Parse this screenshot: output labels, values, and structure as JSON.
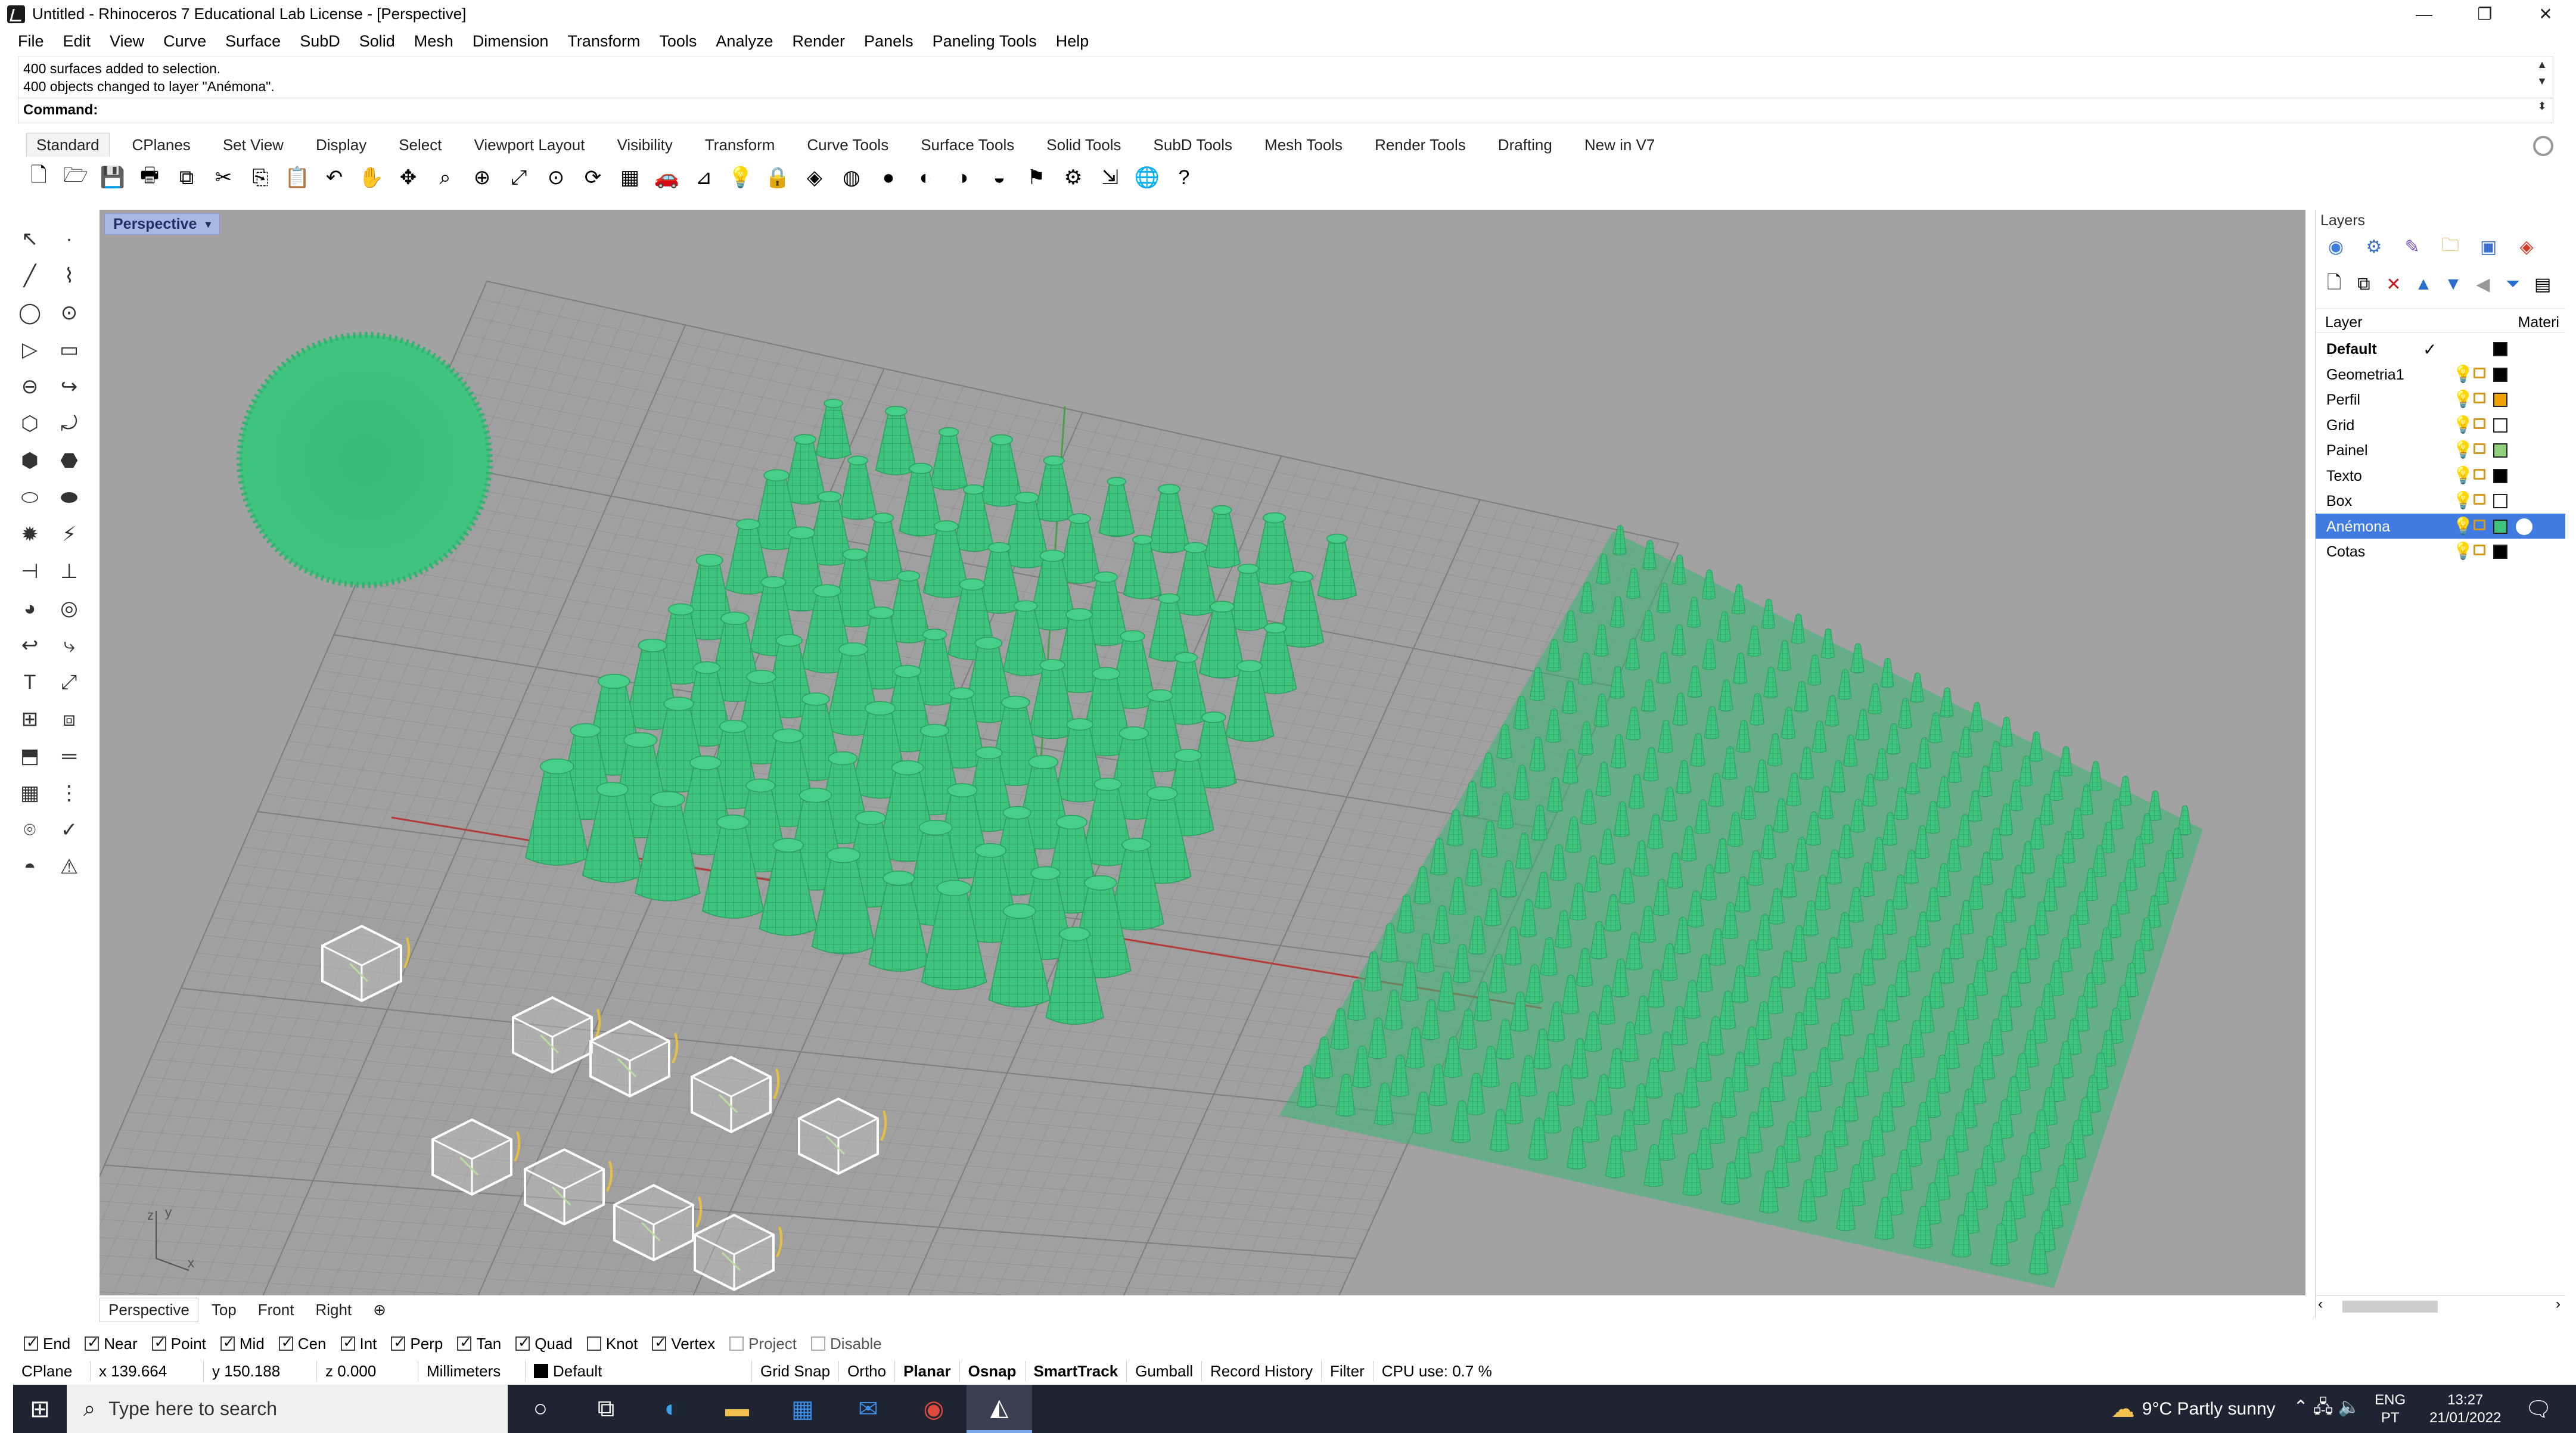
{
  "window": {
    "title": "Untitled - Rhinoceros 7 Educational Lab License - [Perspective]",
    "minimize": "—",
    "restore": "❐",
    "close": "✕"
  },
  "menu": [
    "File",
    "Edit",
    "View",
    "Curve",
    "Surface",
    "SubD",
    "Solid",
    "Mesh",
    "Dimension",
    "Transform",
    "Tools",
    "Analyze",
    "Render",
    "Panels",
    "Paneling Tools",
    "Help"
  ],
  "command_history": {
    "line1": "400 surfaces added to selection.",
    "line2": "400 objects changed to layer \"Anémona\".",
    "prompt": "Command:"
  },
  "toolbar_tabs": [
    "Standard",
    "CPlanes",
    "Set View",
    "Display",
    "Select",
    "Viewport Layout",
    "Visibility",
    "Transform",
    "Curve Tools",
    "Surface Tools",
    "Solid Tools",
    "SubD Tools",
    "Mesh Tools",
    "Render Tools",
    "Drafting",
    "New in V7"
  ],
  "toolbar_icons": [
    "new-icon",
    "open-icon",
    "save-icon",
    "print-icon",
    "import-icon",
    "cut-icon",
    "copy-icon",
    "paste-icon",
    "undo-icon",
    "pan-icon",
    "rotate-view-icon",
    "zoom-dynamic-icon",
    "zoom-window-icon",
    "zoom-extents-icon",
    "zoom-selected-icon",
    "rotate-icon",
    "four-views-icon",
    "car-icon",
    "cplane-icon",
    "point-icon",
    "light-icon",
    "lock-icon",
    "layer-icon",
    "color-wheel-icon",
    "wireframe-icon",
    "shaded-icon",
    "rendered-icon",
    "select-filter-icon",
    "options-gear-icon",
    "history-icon",
    "render-globe-icon",
    "help-icon"
  ],
  "viewport": {
    "name": "Perspective",
    "caret": "▾",
    "tabs": [
      "Perspective",
      "Top",
      "Front",
      "Right"
    ],
    "add_tab": "⊕",
    "axes_z": "z",
    "axes_y": "y",
    "axes_x": "x"
  },
  "layers_panel": {
    "title": "Layers",
    "col_layer": "Layer",
    "col_material": "Materi",
    "rows": [
      {
        "name": "Default",
        "color": "#000000",
        "current": true
      },
      {
        "name": "Geometria1",
        "color": "#000000"
      },
      {
        "name": "Perfil",
        "color": "#f0a000"
      },
      {
        "name": "Grid",
        "color": "#ffffff"
      },
      {
        "name": "Painel",
        "color": "#8fd07a"
      },
      {
        "name": "Texto",
        "color": "#000000"
      },
      {
        "name": "Box",
        "color": "#ffffff"
      },
      {
        "name": "Anémona",
        "color": "#3ec47c",
        "selected": true
      },
      {
        "name": "Cotas",
        "color": "#000000"
      }
    ],
    "check_mark": "✓"
  },
  "osnaps": [
    {
      "label": "End",
      "on": true
    },
    {
      "label": "Near",
      "on": true
    },
    {
      "label": "Point",
      "on": true
    },
    {
      "label": "Mid",
      "on": true
    },
    {
      "label": "Cen",
      "on": true
    },
    {
      "label": "Int",
      "on": true
    },
    {
      "label": "Perp",
      "on": true
    },
    {
      "label": "Tan",
      "on": true
    },
    {
      "label": "Quad",
      "on": true
    },
    {
      "label": "Knot",
      "on": false
    },
    {
      "label": "Vertex",
      "on": true
    },
    {
      "label": "Project",
      "on": false
    },
    {
      "label": "Disable",
      "on": false
    }
  ],
  "status": {
    "cplane": "CPlane",
    "x": "x 139.664",
    "y": "y 150.188",
    "z": "z 0.000",
    "units": "Millimeters",
    "layer": "Default",
    "grid_snap": "Grid Snap",
    "ortho": "Ortho",
    "planar": "Planar",
    "osnap": "Osnap",
    "smarttrack": "SmartTrack",
    "gumball": "Gumball",
    "record_history": "Record History",
    "filter": "Filter",
    "cpu": "CPU use: 0.7 %"
  },
  "taskbar": {
    "search_placeholder": "Type here to search",
    "weather": "9°C  Partly sunny",
    "lang1": "ENG",
    "lang2": "PT",
    "time": "13:27",
    "date": "21/01/2022"
  },
  "colors": {
    "viewport_bg": "#a2a2a2",
    "anemona_green": "#3ec47c",
    "selection_blue": "#3f7be0"
  }
}
